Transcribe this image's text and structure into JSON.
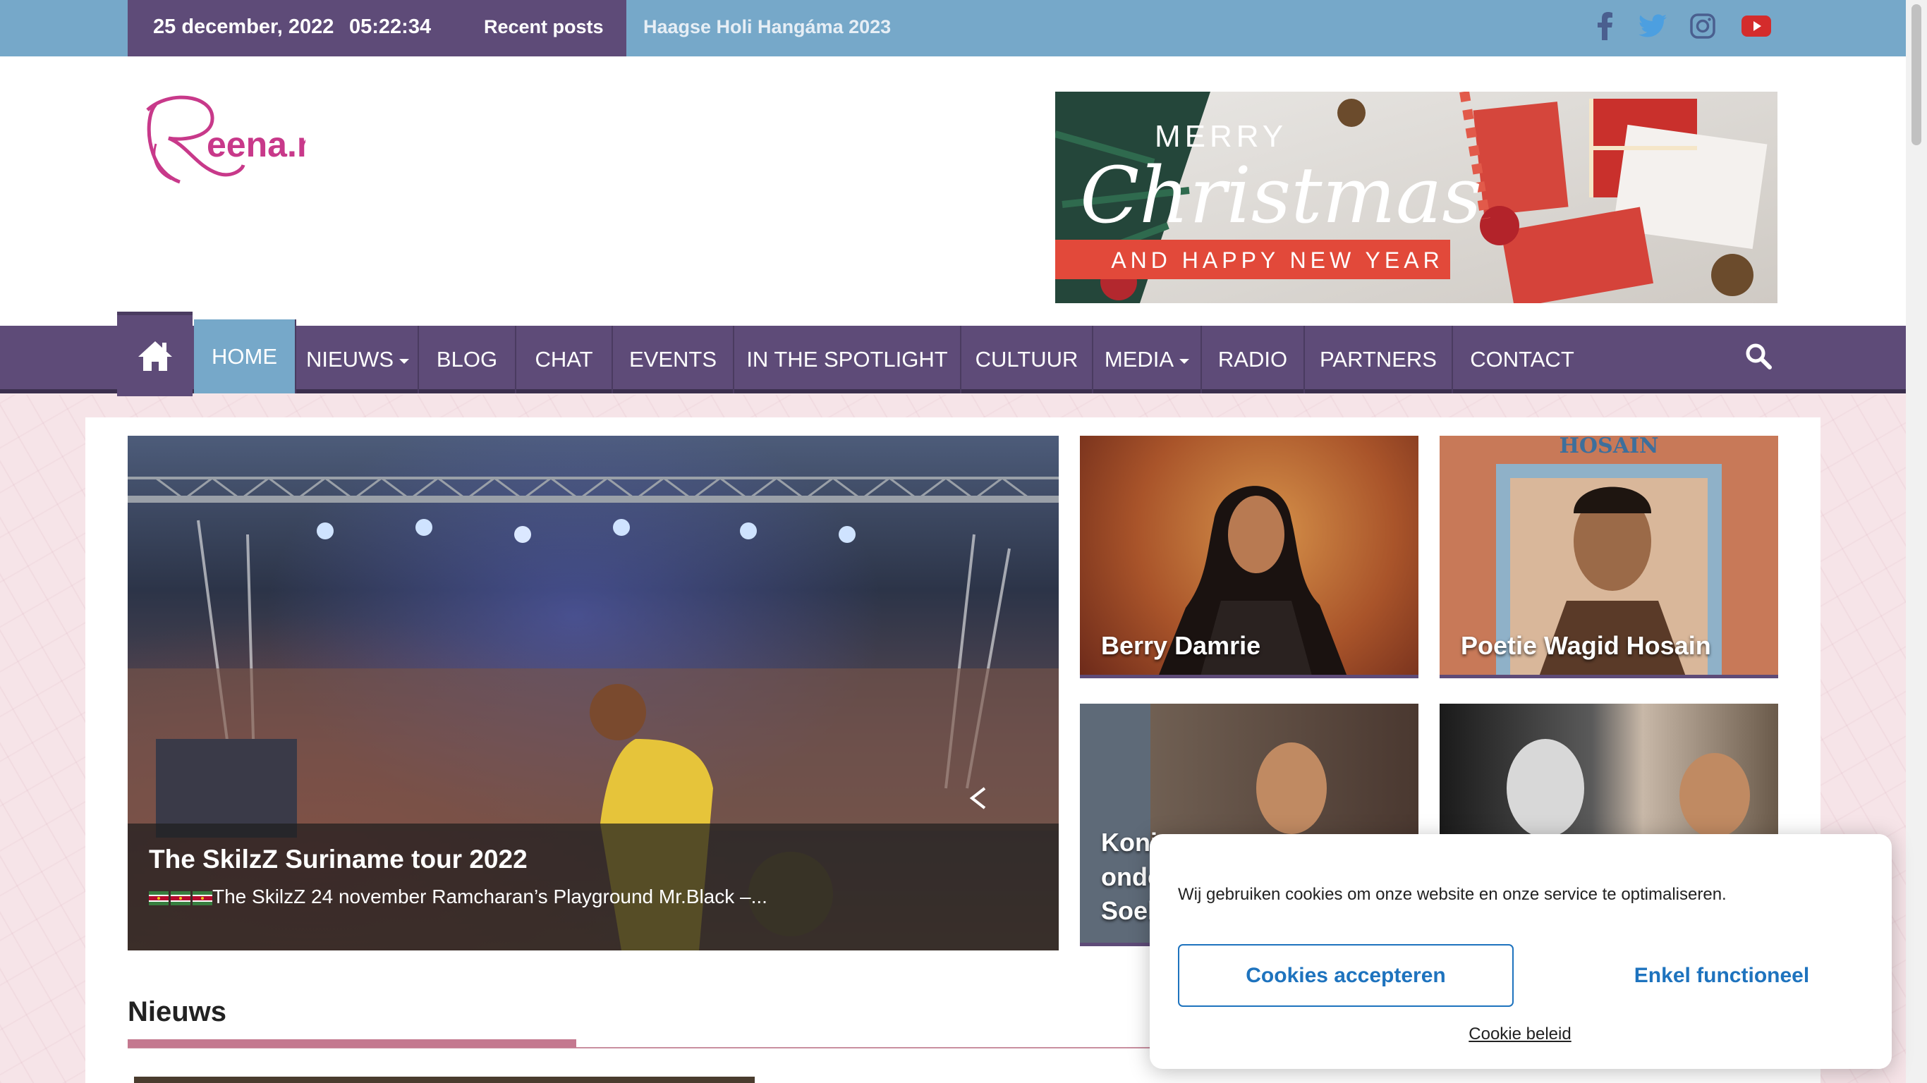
{
  "topbar": {
    "date": "25 december, 2022",
    "time": "05:22:34",
    "recent_label": "Recent posts",
    "ticker": "Haagse Holi Hangáma 2023",
    "social_icons": [
      "facebook-icon",
      "twitter-icon",
      "instagram-icon",
      "youtube-icon"
    ]
  },
  "logo": {
    "text": "Reena.nl",
    "color": "#c8398a"
  },
  "banner": {
    "line1": "MERRY",
    "line2": "Christmas",
    "line3": "AND HAPPY NEW YEAR"
  },
  "nav": {
    "items": [
      {
        "label": "HOME",
        "active": true
      },
      {
        "label": "NIEUWS",
        "dropdown": true
      },
      {
        "label": "BLOG"
      },
      {
        "label": "CHAT"
      },
      {
        "label": "EVENTS"
      },
      {
        "label": "IN THE SPOTLIGHT"
      },
      {
        "label": "CULTUUR"
      },
      {
        "label": "MEDIA",
        "dropdown": true
      },
      {
        "label": "RADIO"
      },
      {
        "label": "PARTNERS"
      },
      {
        "label": "CONTACT"
      }
    ]
  },
  "featured": {
    "title": "The SkilzZ Suriname tour 2022",
    "excerpt": "The SkilzZ 24 november Ramcharan’s Playground Mr.Black –..."
  },
  "tiles": [
    {
      "label": "Berry Damrie"
    },
    {
      "label": "Poetie Wagid Hosain"
    },
    {
      "label": "Koni\nonde\nSoel"
    },
    {
      "label": ""
    }
  ],
  "section": {
    "title": "Nieuws"
  },
  "cookie": {
    "message": "Wij gebruiken cookies om onze website en onze service te optimaliseren.",
    "accept": "Cookies accepteren",
    "functional": "Enkel functioneel",
    "policy": "Cookie beleid"
  },
  "colors": {
    "topbar": "#76a8c9",
    "purple": "#5e4b78",
    "accent_pink": "#c4788f",
    "link_blue": "#1e73be"
  }
}
